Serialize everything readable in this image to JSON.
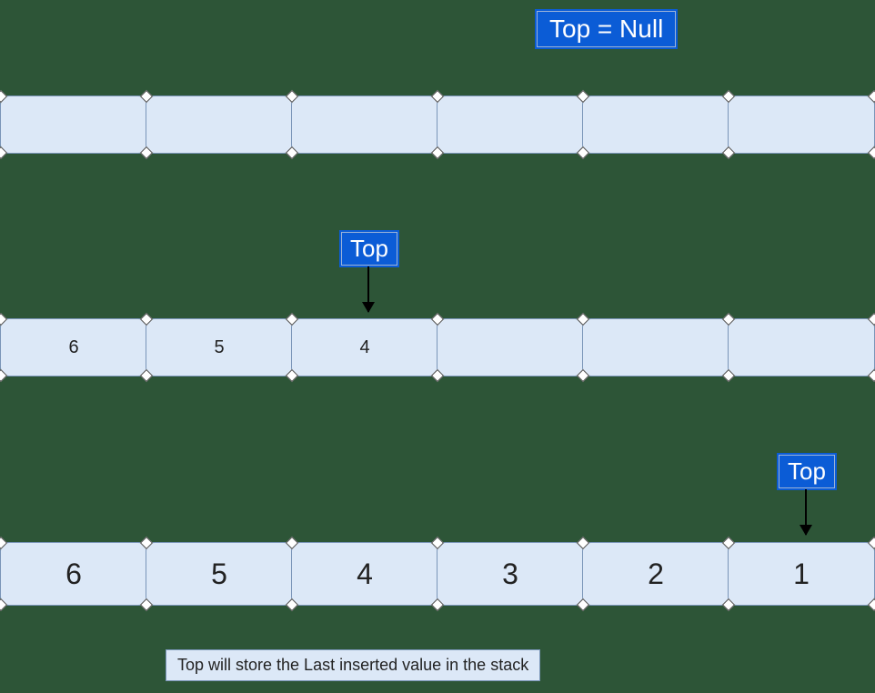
{
  "labels": {
    "topNull": "Top = Null",
    "top1": "Top",
    "top2": "Top"
  },
  "row1": [
    "",
    "",
    "",
    "",
    "",
    ""
  ],
  "row2": [
    "6",
    "5",
    "4",
    "",
    "",
    ""
  ],
  "row3": [
    "6",
    "5",
    "4",
    "3",
    "2",
    "1"
  ],
  "caption": "Top will store the Last inserted value in the stack"
}
